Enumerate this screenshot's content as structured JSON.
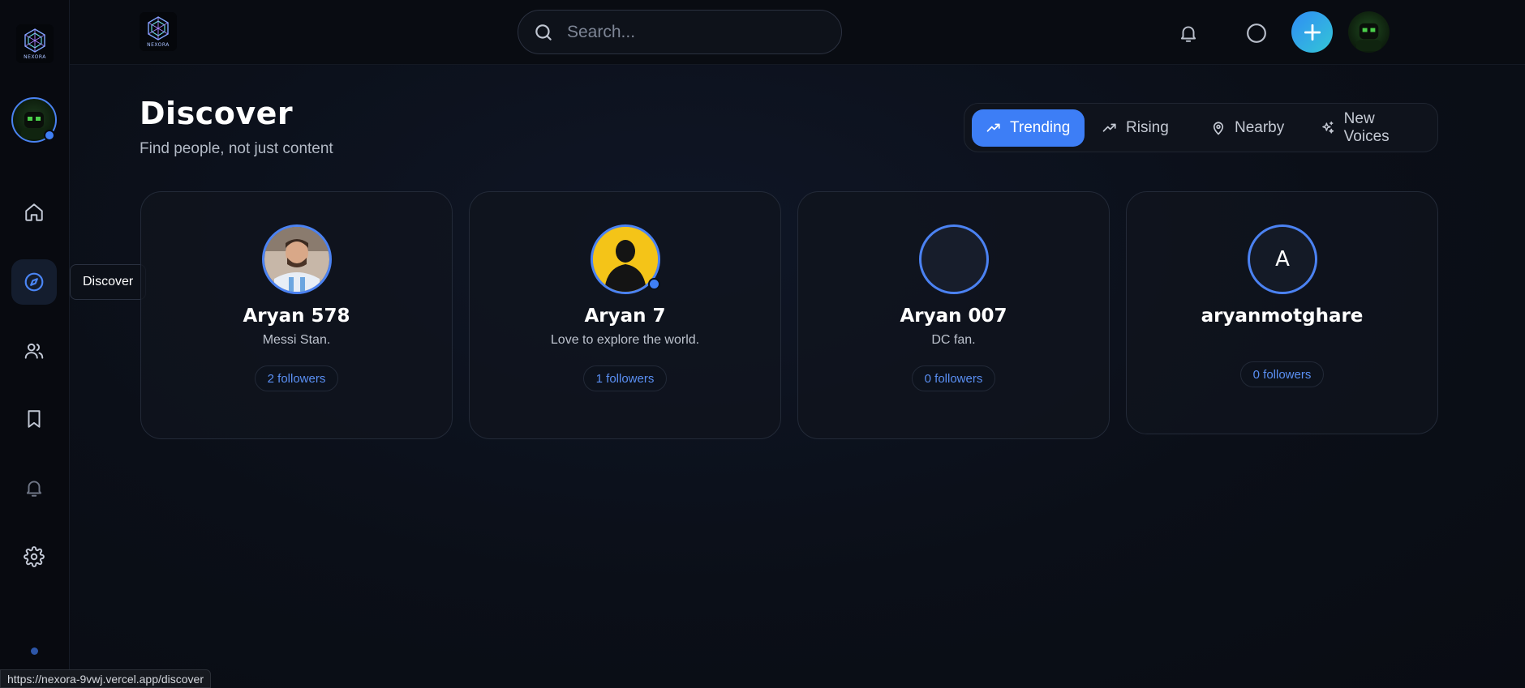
{
  "brand": {
    "logo_text": "NEXORA"
  },
  "search": {
    "placeholder": "Search..."
  },
  "sidebar": {
    "items": [
      {
        "name": "home",
        "icon": "home-icon"
      },
      {
        "name": "discover",
        "icon": "compass-icon",
        "active": true
      },
      {
        "name": "people",
        "icon": "users-icon"
      },
      {
        "name": "saved",
        "icon": "bookmark-icon"
      },
      {
        "name": "notifications",
        "icon": "bell-icon"
      },
      {
        "name": "settings",
        "icon": "gear-icon"
      }
    ],
    "tooltip": "Discover"
  },
  "header": {
    "title": "Discover",
    "subtitle": "Find people, not just content"
  },
  "filters": [
    {
      "label": "Trending",
      "icon": "trending-up-icon",
      "active": true
    },
    {
      "label": "Rising",
      "icon": "trending-up-icon",
      "active": false
    },
    {
      "label": "Nearby",
      "icon": "map-pin-icon",
      "active": false
    },
    {
      "label": "New Voices",
      "icon": "sparkles-icon",
      "active": false
    }
  ],
  "cards": [
    {
      "name": "Aryan 578",
      "bio": "Messi Stan.",
      "followers": "2 followers",
      "avatar": "photo-messi"
    },
    {
      "name": "Aryan 7",
      "bio": "Love to explore the world.",
      "followers": "1 followers",
      "avatar": "silhouette",
      "online": true
    },
    {
      "name": "Aryan 007",
      "bio": "DC fan.",
      "followers": "0 followers",
      "avatar": "empty"
    },
    {
      "name": "aryanmotghare",
      "bio": "",
      "followers": "0 followers",
      "avatar": "letter",
      "avatar_letter": "A"
    }
  ],
  "status_bar": {
    "url": "https://nexora-9vwj.vercel.app/discover"
  },
  "colors": {
    "accent": "#3d7ef6",
    "background": "#0b0f18",
    "plus_gradient_start": "#2f8df5",
    "plus_gradient_end": "#34c6d6"
  }
}
